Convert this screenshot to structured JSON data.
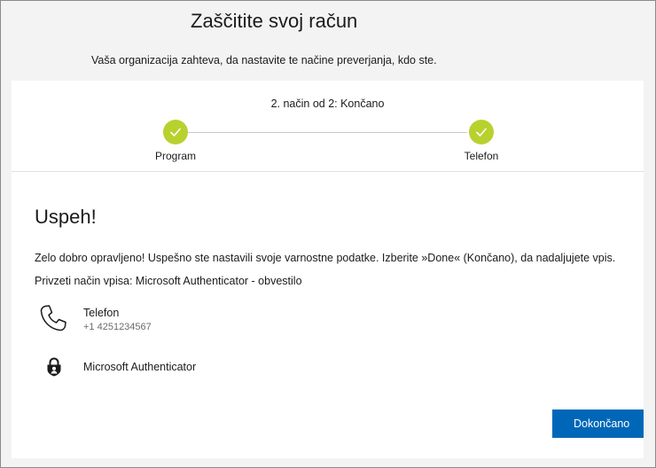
{
  "header": {
    "title": "Zaščitite svoj račun",
    "subtitle": "Vaša organizacija zahteva, da nastavite te načine preverjanja, kdo ste."
  },
  "progress": {
    "caption": "2. način od 2: Končano",
    "current_step": 2,
    "total_steps": 2,
    "accent_color": "#b9d12e",
    "steps": [
      {
        "label": "Program",
        "status": "completed",
        "icon": "checkmark-icon"
      },
      {
        "label": "Telefon",
        "status": "completed",
        "icon": "checkmark-icon"
      }
    ]
  },
  "main": {
    "title": "Uspeh!",
    "message": "Zelo dobro opravljeno! Uspešno ste nastavili svoje varnostne podatke. Izberite »Done« (Končano), da nadaljujete vpis.",
    "default_method": "Privzeti način vpisa: Microsoft Authenticator - obvestilo",
    "methods": [
      {
        "icon": "phone-icon",
        "name": "Telefon",
        "detail": "+1 4251234567"
      },
      {
        "icon": "authenticator-lock-icon",
        "name": "Microsoft Authenticator"
      }
    ],
    "done_button_label": "Dokončano",
    "button_color": "#0067b8"
  }
}
